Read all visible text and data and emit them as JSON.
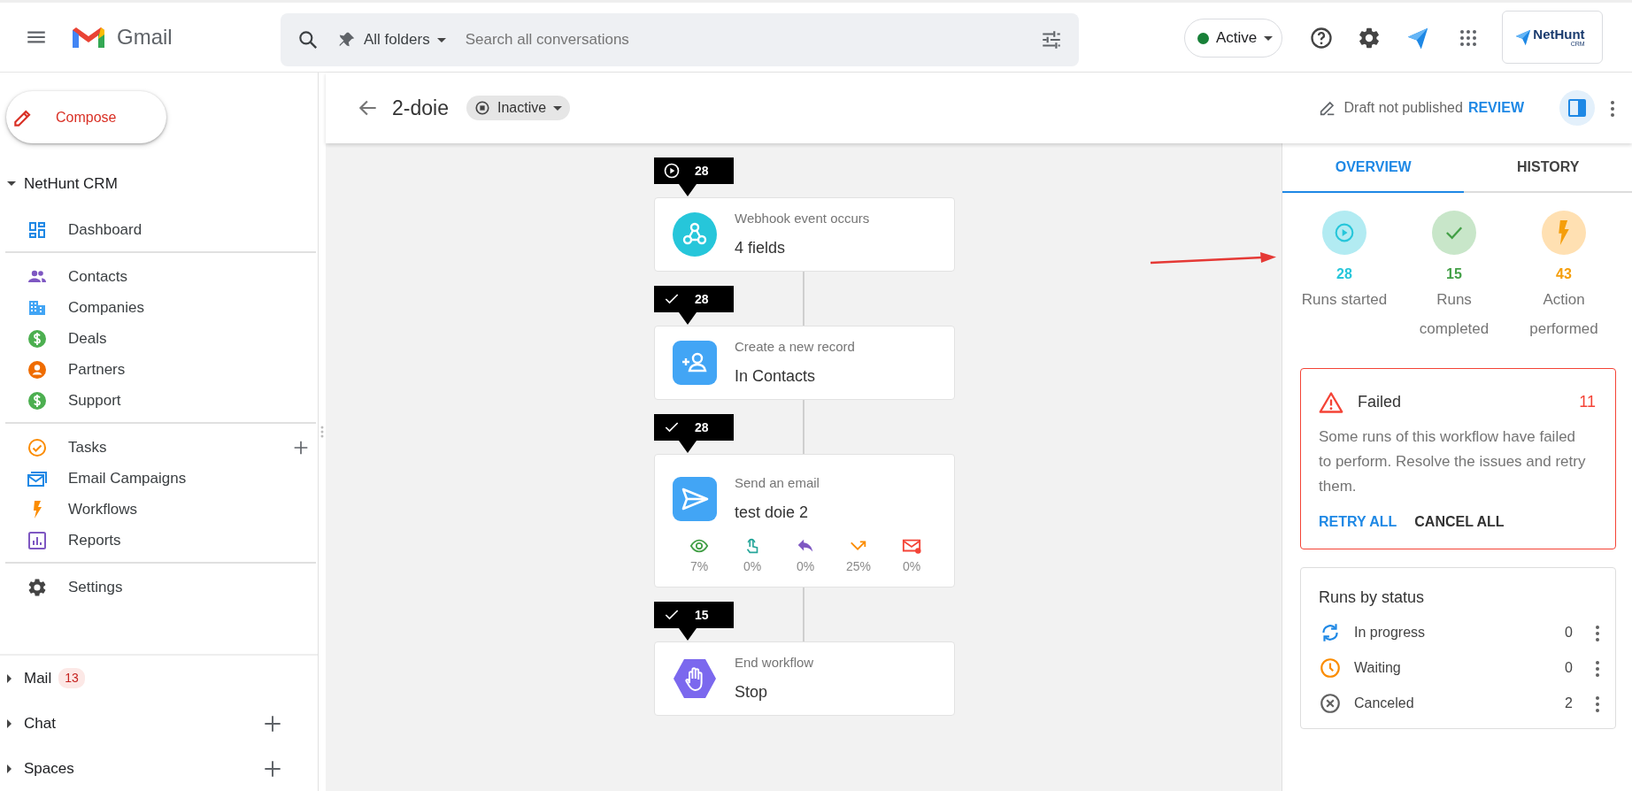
{
  "header": {
    "app_name": "Gmail",
    "search": {
      "scope": "All folders",
      "placeholder": "Search all conversations"
    },
    "status": {
      "label": "Active"
    },
    "logo": {
      "name": "NetHunt",
      "sub": "CRM"
    }
  },
  "sidebar": {
    "compose": "Compose",
    "section": {
      "title": "NetHunt CRM",
      "expanded": true
    },
    "groups": [
      [
        {
          "kind": "dashboard",
          "label": "Dashboard",
          "has_add": false
        }
      ],
      [
        {
          "kind": "contacts",
          "label": "Contacts",
          "has_add": false
        },
        {
          "kind": "companies",
          "label": "Companies",
          "has_add": false
        },
        {
          "kind": "deals",
          "label": "Deals",
          "has_add": false
        },
        {
          "kind": "partners",
          "label": "Partners",
          "has_add": false
        },
        {
          "kind": "support",
          "label": "Support",
          "has_add": false
        }
      ],
      [
        {
          "kind": "tasks",
          "label": "Tasks",
          "has_add": true
        },
        {
          "kind": "campaigns",
          "label": "Email Campaigns",
          "has_add": false
        },
        {
          "kind": "workflows",
          "label": "Workflows",
          "has_add": false
        },
        {
          "kind": "reports",
          "label": "Reports",
          "has_add": false
        }
      ],
      [
        {
          "kind": "settings",
          "label": "Settings",
          "has_add": false
        }
      ]
    ],
    "bottom": [
      {
        "label": "Mail",
        "badge": "13",
        "expanded": false,
        "has_add": false
      },
      {
        "label": "Chat",
        "expanded": false,
        "has_add": true
      },
      {
        "label": "Spaces",
        "expanded": false,
        "has_add": true
      }
    ]
  },
  "workflow": {
    "title": "2-doie",
    "status": "Inactive",
    "draft_note": "Draft not published",
    "review": "REVIEW",
    "steps": [
      {
        "kind": "webhook",
        "counter": {
          "kind": "started",
          "value": "28"
        },
        "label": "Webhook event occurs",
        "title": "4 fields"
      },
      {
        "kind": "create_record",
        "counter": {
          "kind": "completed",
          "value": "28"
        },
        "label": "Create a new record",
        "title": "In Contacts"
      },
      {
        "kind": "email",
        "counter": {
          "kind": "completed",
          "value": "28"
        },
        "label": "Send an email",
        "title": "test doie 2",
        "email_stats": [
          {
            "kind": "opened",
            "value": "7%"
          },
          {
            "kind": "clicked",
            "value": "0%"
          },
          {
            "kind": "replied",
            "value": "0%"
          },
          {
            "kind": "bounced",
            "value": "25%"
          },
          {
            "kind": "failed",
            "value": "0%"
          }
        ]
      },
      {
        "kind": "end",
        "counter": {
          "kind": "completed",
          "value": "15"
        },
        "label": "End workflow",
        "title": "Stop"
      }
    ]
  },
  "panel": {
    "tabs": [
      {
        "label": "OVERVIEW",
        "selected": true
      },
      {
        "label": "HISTORY",
        "selected": false
      }
    ],
    "stats": [
      {
        "kind": "started",
        "value": "28",
        "label": "Runs started"
      },
      {
        "kind": "completed",
        "value": "15",
        "label": "Runs completed"
      },
      {
        "kind": "actions",
        "value": "43",
        "label": "Action performed"
      }
    ],
    "failed": {
      "title": "Failed",
      "count": "11",
      "text": "Some runs of this workflow have failed to perform. Resolve the issues and retry them.",
      "actions": [
        "RETRY ALL",
        "CANCEL ALL"
      ]
    },
    "runs_by_status": {
      "title": "Runs by status",
      "rows": [
        {
          "kind": "in_progress",
          "label": "In progress",
          "count": "0"
        },
        {
          "kind": "waiting",
          "label": "Waiting",
          "count": "0"
        },
        {
          "kind": "canceled",
          "label": "Canceled",
          "count": "2"
        }
      ]
    }
  }
}
